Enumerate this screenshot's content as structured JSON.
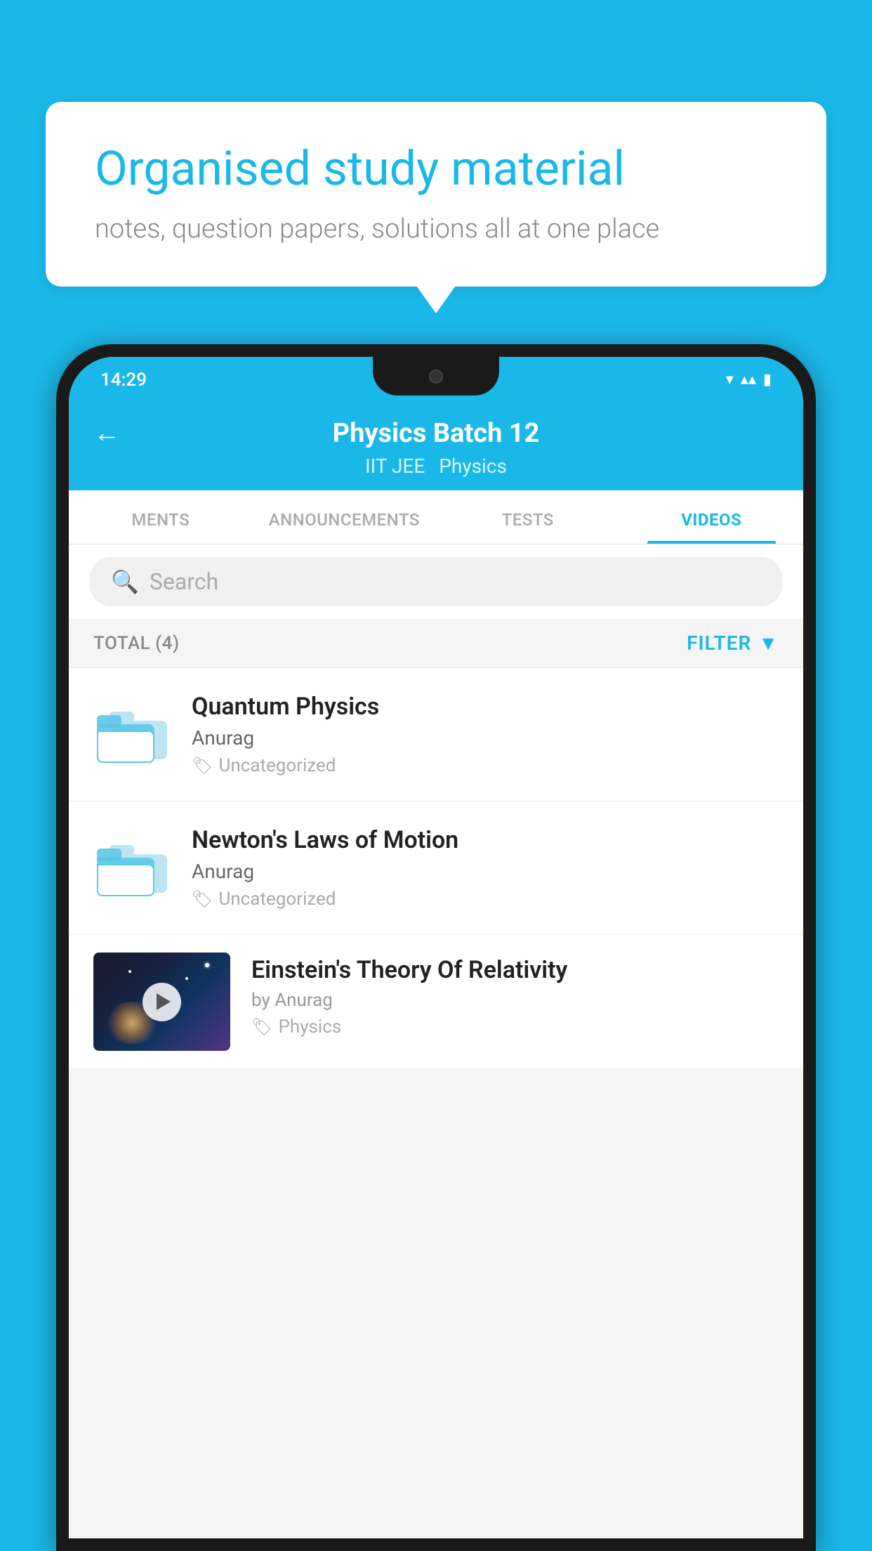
{
  "background_color": "#1ab8e8",
  "speech_bubble": {
    "title": "Organised study material",
    "subtitle": "notes, question papers, solutions all at one place"
  },
  "phone": {
    "status_bar": {
      "time": "14:29",
      "wifi": "▾",
      "signal": "▴▴",
      "battery": "▮"
    },
    "header": {
      "title": "Physics Batch 12",
      "tag1": "IIT JEE",
      "tag2": "Physics",
      "back_label": "←"
    },
    "tabs": [
      {
        "label": "MENTS",
        "active": false
      },
      {
        "label": "ANNOUNCEMENTS",
        "active": false
      },
      {
        "label": "TESTS",
        "active": false
      },
      {
        "label": "VIDEOS",
        "active": true
      }
    ],
    "search": {
      "placeholder": "Search"
    },
    "filter_bar": {
      "total": "TOTAL (4)",
      "filter_label": "FILTER"
    },
    "videos": [
      {
        "title": "Quantum Physics",
        "author": "Anurag",
        "tag": "Uncategorized",
        "has_thumbnail": false
      },
      {
        "title": "Newton's Laws of Motion",
        "author": "Anurag",
        "tag": "Uncategorized",
        "has_thumbnail": false
      },
      {
        "title": "Einstein's Theory Of Relativity",
        "author": "by Anurag",
        "tag": "Physics",
        "has_thumbnail": true
      }
    ]
  }
}
